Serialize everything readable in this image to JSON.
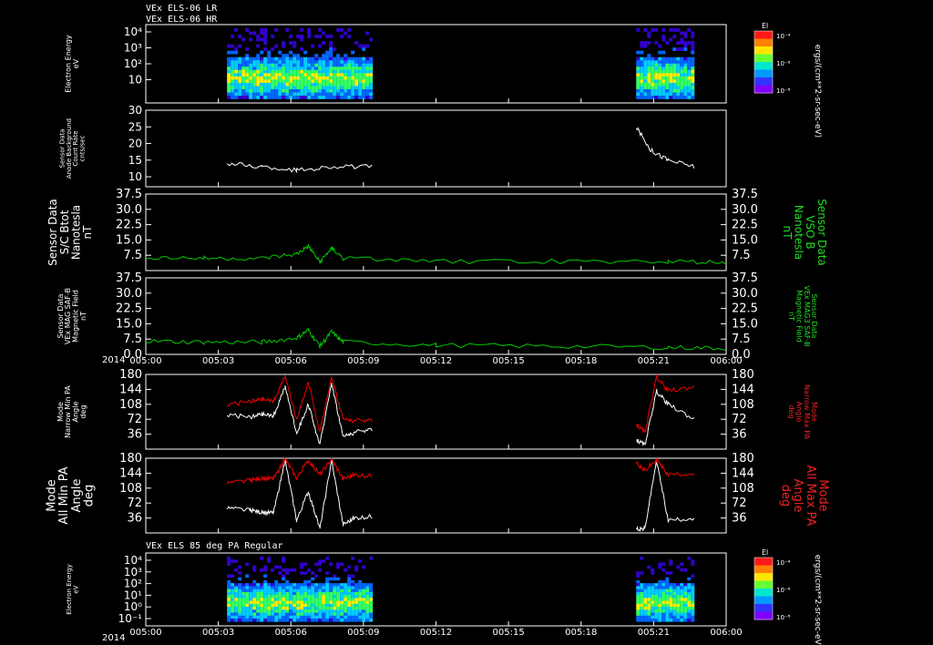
{
  "header": {
    "line1": "VEx ELS-06 LR",
    "line2": "VEx ELS-06 HR",
    "bottom_panel_title": "VEx ELS 85 deg PA Regular"
  },
  "colorbar": {
    "label": "El",
    "units": "ergs/(cm**2-sr-sec-eV)",
    "ticks": [
      "10⁻⁴",
      "10⁻⁶",
      "10⁻⁸"
    ],
    "colors": [
      "#ff1a1a",
      "#ff8000",
      "#ffe600",
      "#66ff33",
      "#00e6cc",
      "#0099ff",
      "#3333ff",
      "#8000ff"
    ]
  },
  "time_axis": {
    "year": "2014",
    "ticks": [
      "005:00",
      "005:03",
      "005:06",
      "005:09",
      "005:12",
      "005:15",
      "005:18",
      "005:21",
      "006:00"
    ]
  },
  "chart_data": [
    {
      "id": "electron-energy-1",
      "type": "heatmap",
      "ylabel": [
        "Electron Energy",
        "eV"
      ],
      "y_ticks": [
        "10⁴",
        "10³",
        "10²",
        "10"
      ],
      "log_scale": true,
      "data_intervals": [
        [
          0.14,
          0.39
        ],
        [
          0.845,
          0.945
        ]
      ],
      "colors": [
        "#3300cc",
        "#0066ff",
        "#00ccff",
        "#33ff66",
        "#ffee00",
        "#ff6600"
      ]
    },
    {
      "id": "anode-background",
      "type": "line",
      "ylabel": [
        "Sensor Data",
        "Anode Background",
        "Count Rate",
        "cnts/sec"
      ],
      "y_ticks": [
        "30",
        "25",
        "20",
        "15",
        "10"
      ],
      "ylim": [
        7,
        30
      ],
      "series": [
        {
          "color": "#ffffff",
          "segments": [
            {
              "x": [
                0.14,
                0.2,
                0.26,
                0.32,
                0.39
              ],
              "y": [
                14,
                13,
                12,
                13,
                13
              ]
            },
            {
              "x": [
                0.845,
                0.87,
                0.9,
                0.945
              ],
              "y": [
                25,
                18,
                15,
                13
              ]
            }
          ]
        }
      ]
    },
    {
      "id": "sc-btot",
      "type": "line",
      "ylabel": [
        "Sensor Data",
        "S/C Btot",
        "Nanotesla",
        "nT"
      ],
      "ylabel_right": [
        "Sensor Data",
        "VSO B",
        "Nanotesla",
        "nT"
      ],
      "y_ticks": [
        "37.5",
        "30.0",
        "22.5",
        "15.0",
        "7.5"
      ],
      "ylim": [
        0,
        37.5
      ],
      "series": [
        {
          "color": "#00cc00",
          "segments": [
            {
              "x": [
                0.0,
                0.1,
                0.2,
                0.26,
                0.28,
                0.3,
                0.32,
                0.34,
                0.5,
                0.7,
                0.9,
                1.0
              ],
              "y": [
                6.5,
                6,
                6,
                8,
                12,
                4,
                11,
                6,
                4.5,
                4.5,
                4.5,
                4
              ]
            }
          ]
        }
      ]
    },
    {
      "id": "mag3-saf-b",
      "type": "line",
      "ylabel": [
        "Sensor Data",
        "VEx MAG SAF-B",
        "Magnetic Field",
        "nT"
      ],
      "ylabel_right": [
        "Sensor Data",
        "VEx MAG3 SAF-B",
        "Magnetic Field",
        "nT"
      ],
      "y_ticks": [
        "37.5",
        "30.0",
        "22.5",
        "15.0",
        "7.5",
        "0.0"
      ],
      "ylim": [
        0,
        37.5
      ],
      "series": [
        {
          "color": "#00cc00",
          "segments": [
            {
              "x": [
                0.0,
                0.1,
                0.2,
                0.26,
                0.28,
                0.3,
                0.32,
                0.34,
                0.5,
                0.7,
                0.9,
                1.0
              ],
              "y": [
                6.5,
                6,
                6,
                8,
                12,
                4,
                11,
                6,
                4.5,
                4,
                3.5,
                3
              ]
            }
          ]
        }
      ]
    },
    {
      "id": "narrow-pa",
      "type": "line",
      "ylabel": [
        "Mode",
        "Narrow Min PA",
        "Angle",
        "deg"
      ],
      "ylabel_right": [
        "Mode",
        "Narrow Max PA",
        "Angle",
        "deg"
      ],
      "y_ticks": [
        "180",
        "144",
        "108",
        "72",
        "36"
      ],
      "ylim": [
        0,
        180
      ],
      "series": [
        {
          "color": "#ffffff",
          "segments": [
            {
              "x": [
                0.14,
                0.18,
                0.2,
                0.22,
                0.24,
                0.26,
                0.28,
                0.3,
                0.32,
                0.34,
                0.36,
                0.39
              ],
              "y": [
                84,
                76,
                84,
                80,
                150,
                38,
                108,
                10,
                160,
                30,
                40,
                48
              ]
            },
            {
              "x": [
                0.845,
                0.86,
                0.88,
                0.9,
                0.945
              ],
              "y": [
                22,
                10,
                140,
                108,
                72
              ]
            }
          ]
        },
        {
          "color": "#ee0000",
          "segments": [
            {
              "x": [
                0.14,
                0.18,
                0.2,
                0.22,
                0.24,
                0.26,
                0.28,
                0.3,
                0.32,
                0.34,
                0.36,
                0.39
              ],
              "y": [
                108,
                114,
                120,
                116,
                175,
                72,
                162,
                40,
                175,
                72,
                68,
                70
              ]
            },
            {
              "x": [
                0.845,
                0.86,
                0.88,
                0.9,
                0.945
              ],
              "y": [
                60,
                40,
                175,
                140,
                150
              ]
            }
          ]
        }
      ]
    },
    {
      "id": "all-pa",
      "type": "line",
      "ylabel": [
        "Mode",
        "All Min PA",
        "Angle",
        "deg"
      ],
      "ylabel_right": [
        "Mode",
        "All Max PA",
        "Angle",
        "deg"
      ],
      "y_ticks": [
        "180",
        "144",
        "108",
        "72",
        "36"
      ],
      "ylim": [
        0,
        180
      ],
      "series": [
        {
          "color": "#ffffff",
          "segments": [
            {
              "x": [
                0.14,
                0.18,
                0.2,
                0.22,
                0.24,
                0.26,
                0.28,
                0.3,
                0.32,
                0.34,
                0.36,
                0.39
              ],
              "y": [
                60,
                54,
                50,
                48,
                175,
                30,
                100,
                10,
                175,
                20,
                36,
                40
              ]
            },
            {
              "x": [
                0.845,
                0.86,
                0.88,
                0.9,
                0.945
              ],
              "y": [
                10,
                10,
                175,
                30,
                36
              ]
            }
          ]
        },
        {
          "color": "#ee0000",
          "segments": [
            {
              "x": [
                0.14,
                0.18,
                0.2,
                0.22,
                0.24,
                0.26,
                0.28,
                0.3,
                0.32,
                0.34,
                0.36,
                0.39
              ],
              "y": [
                120,
                126,
                132,
                130,
                178,
                132,
                175,
                140,
                178,
                130,
                140,
                138
              ]
            },
            {
              "x": [
                0.845,
                0.86,
                0.88,
                0.9,
                0.945
              ],
              "y": [
                170,
                150,
                176,
                140,
                144
              ]
            }
          ]
        }
      ]
    },
    {
      "id": "electron-energy-85",
      "type": "heatmap",
      "ylabel": [
        "Electron Energy",
        "eV"
      ],
      "y_ticks": [
        "10⁴",
        "10³",
        "10²",
        "10¹",
        "10⁰",
        "10⁻¹"
      ],
      "log_scale": true,
      "data_intervals": [
        [
          0.14,
          0.39
        ],
        [
          0.845,
          0.945
        ]
      ],
      "colors": [
        "#3300cc",
        "#0066ff",
        "#00ccff",
        "#33ff66",
        "#ffee00",
        "#ff6600"
      ]
    }
  ]
}
